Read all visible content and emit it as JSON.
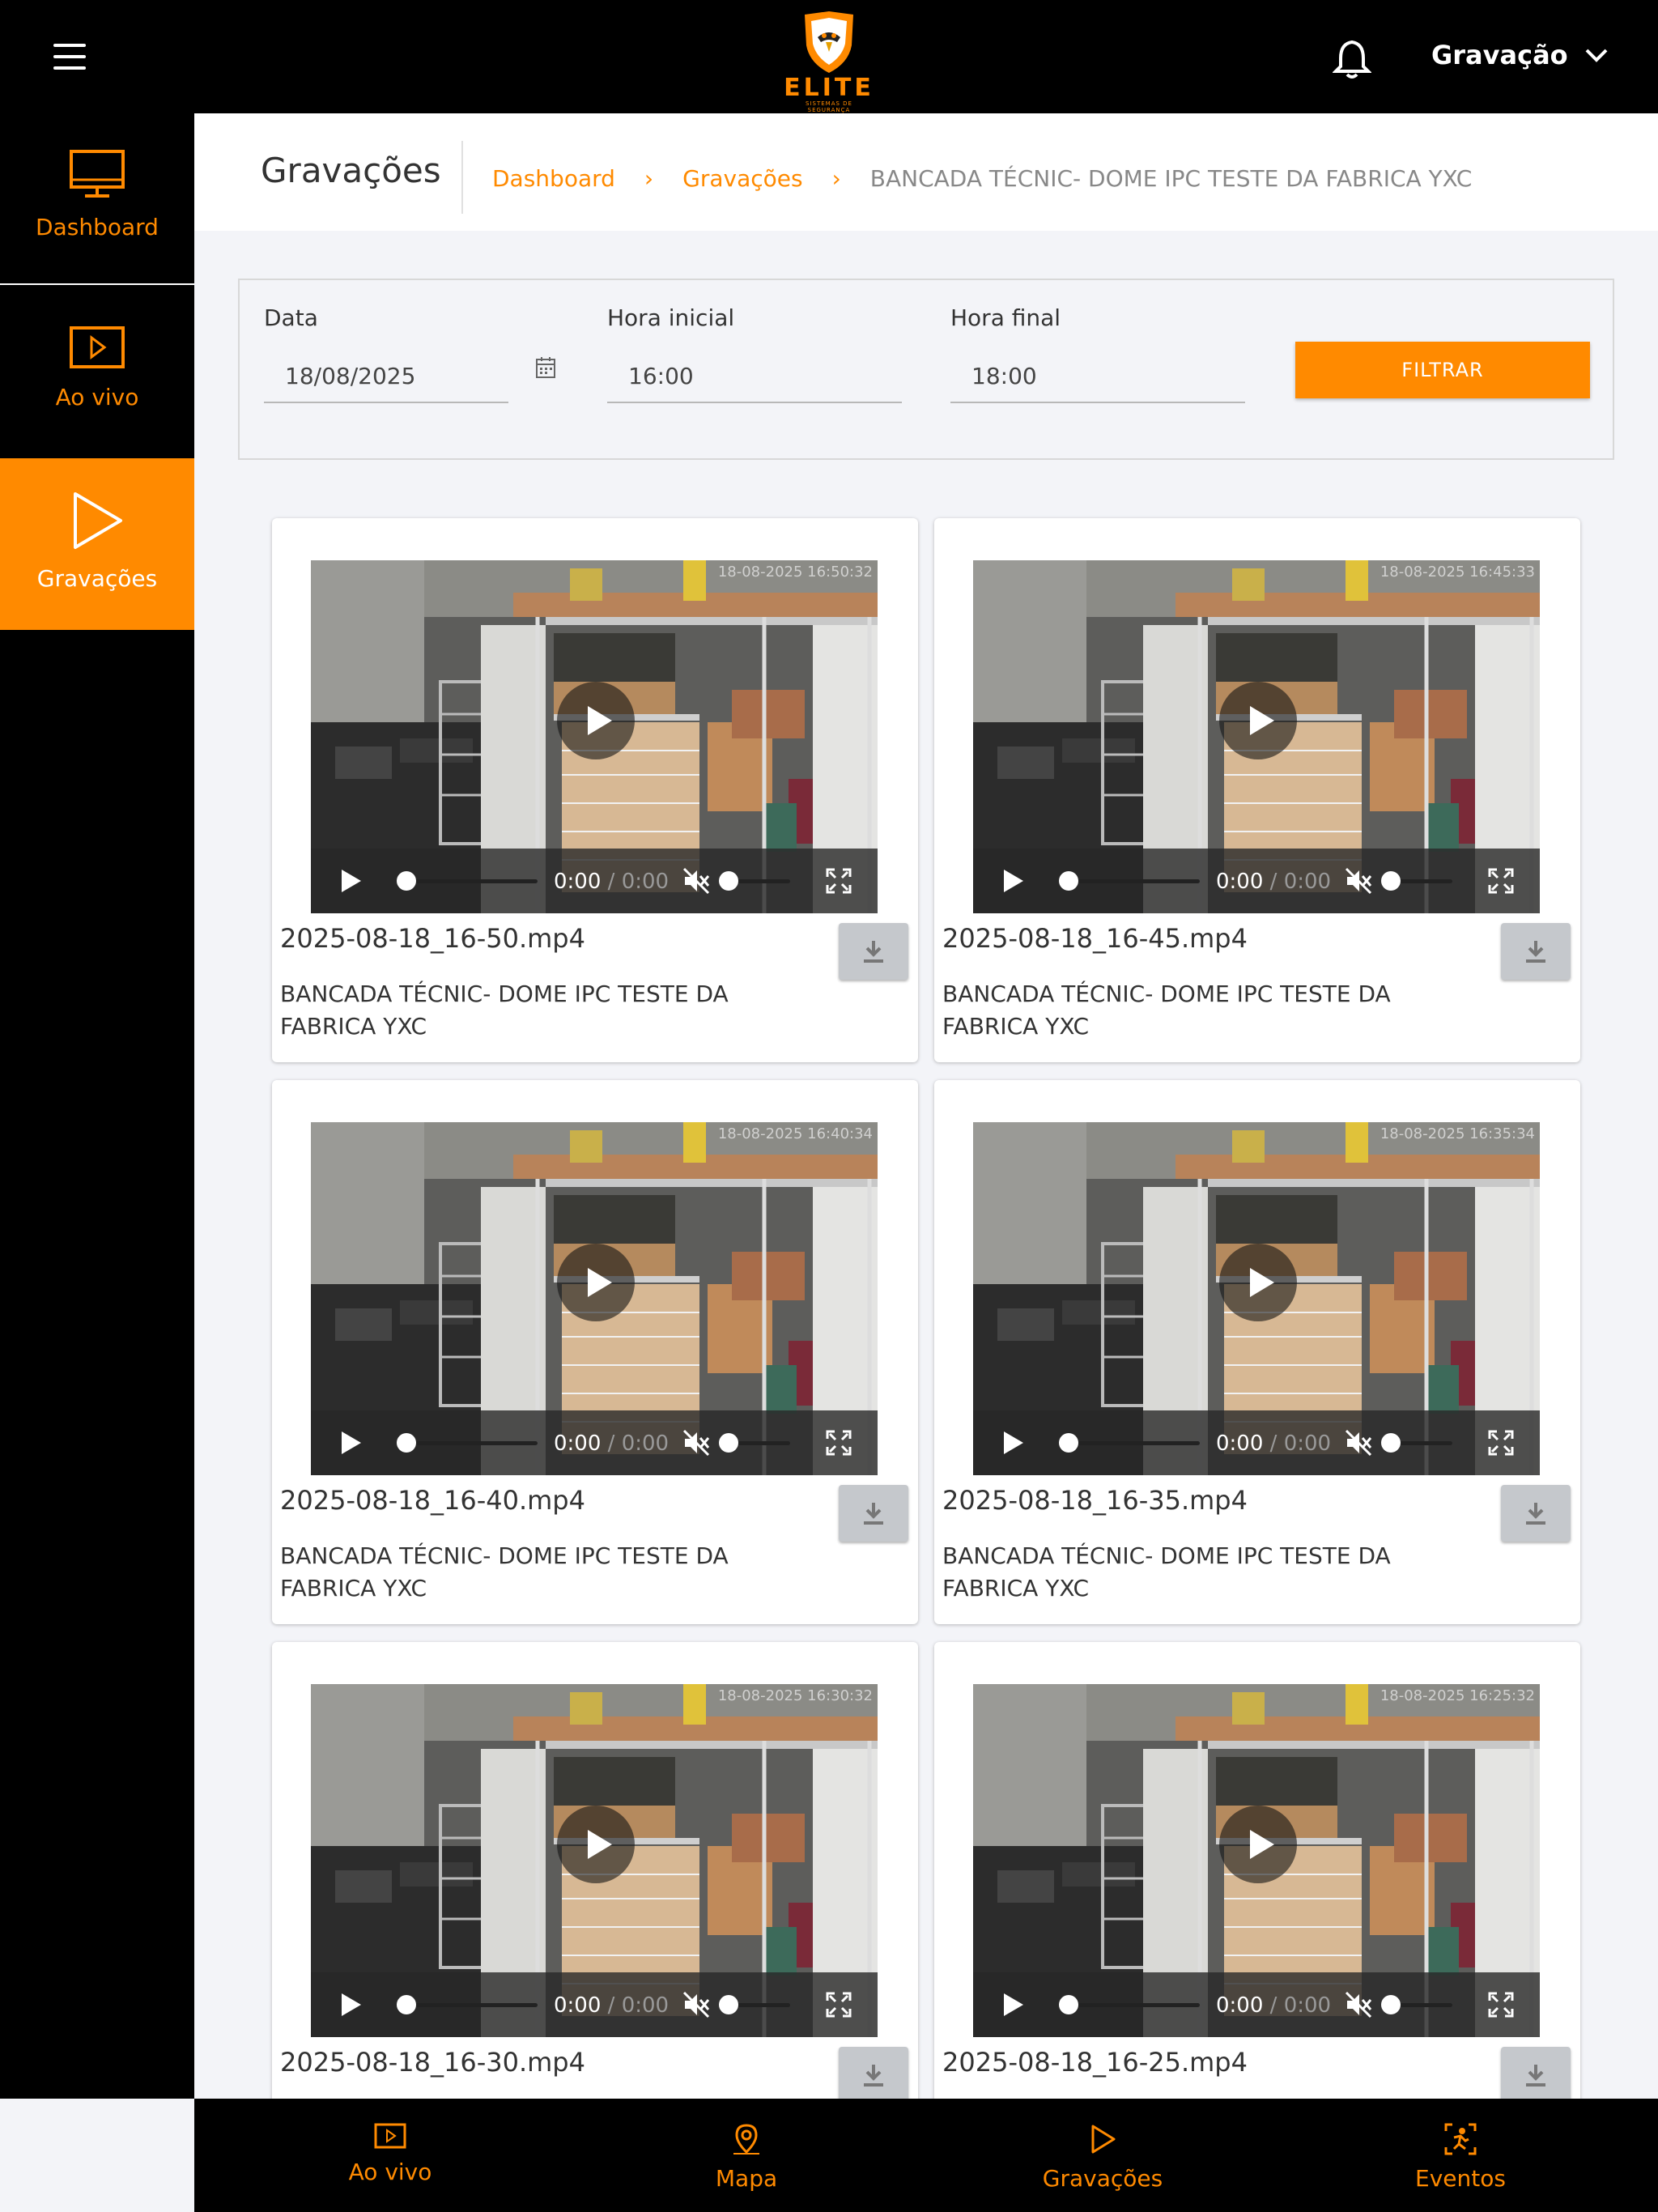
{
  "topbar": {
    "logo_text": "ELITE",
    "logo_sub": "SISTEMAS DE SEGURANÇA",
    "user_menu_label": "Gravação"
  },
  "sidebar": {
    "items": [
      {
        "label": "Dashboard",
        "icon": "monitor-icon"
      },
      {
        "label": "Ao vivo",
        "icon": "play-square-icon"
      },
      {
        "label": "Gravações",
        "icon": "play-icon",
        "active": true
      }
    ]
  },
  "header": {
    "title": "Gravações",
    "breadcrumb": [
      "Dashboard",
      "Gravações"
    ],
    "breadcrumb_current": "BANCADA TÉCNIC- DOME IPC TESTE DA FABRICA YXC"
  },
  "filter": {
    "date_label": "Data",
    "date_value": "18/08/2025",
    "start_label": "Hora inicial",
    "start_value": "16:00",
    "end_label": "Hora final",
    "end_value": "18:00",
    "button_label": "FILTRAR"
  },
  "player": {
    "current_time": "0:00",
    "separator": " / ",
    "duration": "0:00"
  },
  "recordings": [
    {
      "file": "2025-08-18_16-50.mp4",
      "camera": "BANCADA TÉCNIC- DOME IPC TESTE DA FABRICA YXC",
      "timestamp": "18-08-2025 16:50:32"
    },
    {
      "file": "2025-08-18_16-45.mp4",
      "camera": "BANCADA TÉCNIC- DOME IPC TESTE DA FABRICA YXC",
      "timestamp": "18-08-2025 16:45:33"
    },
    {
      "file": "2025-08-18_16-40.mp4",
      "camera": "BANCADA TÉCNIC- DOME IPC TESTE DA FABRICA YXC",
      "timestamp": "18-08-2025 16:40:34"
    },
    {
      "file": "2025-08-18_16-35.mp4",
      "camera": "BANCADA TÉCNIC- DOME IPC TESTE DA FABRICA YXC",
      "timestamp": "18-08-2025 16:35:34"
    },
    {
      "file": "2025-08-18_16-30.mp4",
      "camera": "",
      "timestamp": "18-08-2025 16:30:32"
    },
    {
      "file": "2025-08-18_16-25.mp4",
      "camera": "",
      "timestamp": "18-08-2025 16:25:32"
    }
  ],
  "bottom_nav": [
    {
      "label": "Ao vivo",
      "icon": "play-square-icon"
    },
    {
      "label": "Mapa",
      "icon": "map-pin-icon"
    },
    {
      "label": "Gravações",
      "icon": "play-icon"
    },
    {
      "label": "Eventos",
      "icon": "person-scan-icon"
    }
  ],
  "colors": {
    "accent": "#ff8a00",
    "bar": "#000000",
    "background": "#f3f4f8"
  }
}
